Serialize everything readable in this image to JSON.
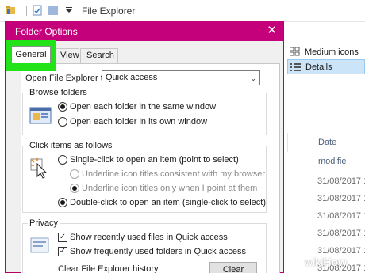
{
  "explorer": {
    "title": "File Explorer",
    "ribbon": [
      {
        "label": "Medium icons",
        "icon": "medium-icons-icon"
      },
      {
        "label": "Details",
        "icon": "details-view-icon",
        "selected": true
      }
    ],
    "column_header": "Date modifie",
    "dates": [
      "31/08/2017 1",
      "31/08/2017 1",
      "31/08/2017 1",
      "31/08/2017 1",
      "31/08/2017 1",
      "31/08/2017 1"
    ]
  },
  "dialog": {
    "title": "Folder Options",
    "close_glyph": "✕",
    "tabs": [
      {
        "label": "General",
        "active": true
      },
      {
        "label": "View"
      },
      {
        "label": "Search"
      }
    ],
    "open_label": "Open File Explorer to:",
    "open_value": "Quick access",
    "browse": {
      "title": "Browse folders",
      "options": [
        {
          "label": "Open each folder in the same window",
          "checked": true
        },
        {
          "label": "Open each folder in its own window",
          "checked": false
        }
      ]
    },
    "click": {
      "title": "Click items as follows",
      "single": "Single-click to open an item (point to select)",
      "underline_browser": "Underline icon titles consistent with my browser",
      "underline_point": "Underline icon titles only when I point at them",
      "double": "Double-click to open an item (single-click to select)"
    },
    "privacy": {
      "title": "Privacy",
      "recent_files": "Show recently used files in Quick access",
      "frequent_folders": "Show frequently used folders in Quick access",
      "clear_label": "Clear File Explorer history",
      "clear_button": "Clear"
    }
  },
  "highlight_color": "#22e218",
  "title_color": "#c4007a",
  "watermark": {
    "wiki": "wiki",
    "how": "How"
  }
}
